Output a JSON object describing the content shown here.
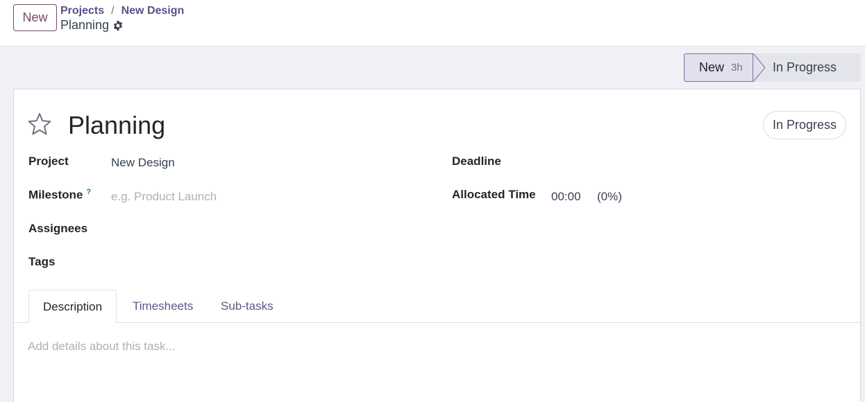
{
  "control_panel": {
    "new_button": "New",
    "breadcrumb": {
      "parent": "Projects",
      "separator": "/",
      "current_project": "New Design"
    },
    "record_title": "Planning",
    "gear_icon": "gear-icon"
  },
  "statusbar": {
    "stages": [
      {
        "label": "New",
        "duration": "3h",
        "active": true
      },
      {
        "label": "In Progress",
        "active": false
      }
    ]
  },
  "task": {
    "name": "Planning",
    "state_badge": "In Progress",
    "star_icon": "star-outline-icon"
  },
  "fields": {
    "project": {
      "label": "Project",
      "value": "New Design"
    },
    "milestone": {
      "label": "Milestone",
      "help": "?",
      "placeholder": "e.g. Product Launch"
    },
    "assignees": {
      "label": "Assignees"
    },
    "tags": {
      "label": "Tags"
    },
    "deadline": {
      "label": "Deadline"
    },
    "allocated_time": {
      "label": "Allocated Time",
      "value": "00:00",
      "percent": "(0%)"
    }
  },
  "tabs": [
    {
      "label": "Description",
      "active": true
    },
    {
      "label": "Timesheets",
      "active": false
    },
    {
      "label": "Sub-tasks",
      "active": false
    }
  ],
  "description": {
    "placeholder": "Add details about this task..."
  },
  "colors": {
    "brand": "#714b67",
    "link": "#5b4f8a",
    "help": "#017e84"
  }
}
